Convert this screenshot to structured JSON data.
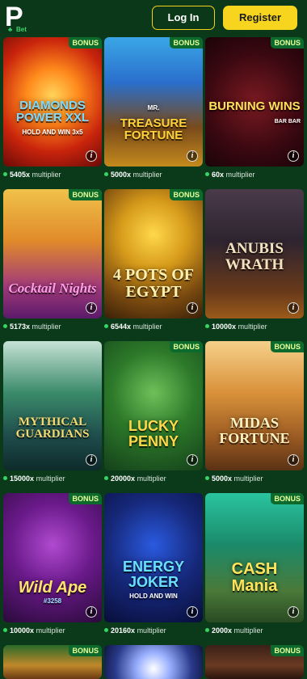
{
  "header": {
    "logo_letter": "P",
    "logo_sub": "Bet",
    "login_label": "Log In",
    "register_label": "Register"
  },
  "colors": {
    "background": "#0a3a1a",
    "accent_yellow": "#f7d51e",
    "bonus_bg": "#0c6a2c",
    "dot_green": "#37d663"
  },
  "badge_label": "BONUS",
  "multiplier_word": "multiplier",
  "games": [
    {
      "title": "DIAMONDS POWER XXL",
      "subtitle": "HOLD AND WIN 3x5",
      "multiplier": "5405x",
      "bonus": true
    },
    {
      "title": "TREASURE FORTUNE",
      "subtitle": "MR.",
      "multiplier": "5000x",
      "bonus": true
    },
    {
      "title": "BURNING WINS",
      "subtitle": "BAR BAR",
      "multiplier": "60x",
      "bonus": true
    },
    {
      "title": "Cocktail Nights",
      "subtitle": "",
      "multiplier": "5173x",
      "bonus": true
    },
    {
      "title": "4 POTS OF EGYPT",
      "subtitle": "",
      "multiplier": "6544x",
      "bonus": true
    },
    {
      "title": "ANUBIS WRATH",
      "subtitle": "",
      "multiplier": "10000x",
      "bonus": false
    },
    {
      "title": "MYTHICAL GUARDIANS",
      "subtitle": "",
      "multiplier": "15000x",
      "bonus": false
    },
    {
      "title": "LUCKY PENNY",
      "subtitle": "",
      "multiplier": "20000x",
      "bonus": true
    },
    {
      "title": "MIDAS FORTUNE",
      "subtitle": "",
      "multiplier": "5000x",
      "bonus": true
    },
    {
      "title": "Wild Ape",
      "subtitle": "#3258",
      "multiplier": "10000x",
      "bonus": true
    },
    {
      "title": "ENERGY JOKER",
      "subtitle": "HOLD AND WIN",
      "multiplier": "20160x",
      "bonus": false
    },
    {
      "title": "CASH Mania",
      "subtitle": "",
      "multiplier": "2000x",
      "bonus": true
    },
    {
      "title": "",
      "subtitle": "",
      "multiplier": "",
      "bonus": true
    },
    {
      "title": "",
      "subtitle": "",
      "multiplier": "",
      "bonus": false
    },
    {
      "title": "",
      "subtitle": "",
      "multiplier": "",
      "bonus": true
    }
  ]
}
